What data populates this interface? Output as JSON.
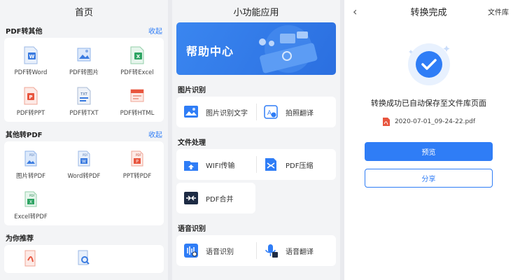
{
  "home": {
    "title": "首页",
    "pdf_to_other": {
      "heading": "PDF转其他",
      "action": "收起",
      "items": [
        {
          "label": "PDF转Word",
          "icon": "word-doc-icon"
        },
        {
          "label": "PDF转图片",
          "icon": "image-doc-icon"
        },
        {
          "label": "PDF转Excel",
          "icon": "excel-doc-icon"
        },
        {
          "label": "PDF转PPT",
          "icon": "ppt-doc-icon"
        },
        {
          "label": "PDF转TXT",
          "icon": "txt-doc-icon"
        },
        {
          "label": "PDF转HTML",
          "icon": "html-doc-icon"
        }
      ]
    },
    "other_to_pdf": {
      "heading": "其他转PDF",
      "action": "收起",
      "items": [
        {
          "label": "图片转PDF",
          "icon": "image-pdf-icon"
        },
        {
          "label": "Word转PDF",
          "icon": "word-pdf-icon"
        },
        {
          "label": "PPT转PDF",
          "icon": "ppt-pdf-icon"
        },
        {
          "label": "Excel转PDF",
          "icon": "excel-pdf-icon"
        }
      ]
    },
    "recommend": {
      "heading": "为你推荐"
    }
  },
  "tools": {
    "title": "小功能应用",
    "banner_text": "帮助中心",
    "groups": [
      {
        "heading": "图片识别",
        "items": [
          {
            "label": "图片识别文字",
            "icon": "image-text-icon"
          },
          {
            "label": "拍照翻译",
            "icon": "photo-translate-icon"
          }
        ]
      },
      {
        "heading": "文件处理",
        "items": [
          {
            "label": "WIFI传输",
            "icon": "wifi-transfer-icon"
          },
          {
            "label": "PDF压缩",
            "icon": "pdf-compress-icon"
          },
          {
            "label": "PDF合并",
            "icon": "pdf-merge-icon"
          }
        ]
      },
      {
        "heading": "语音识别",
        "items": [
          {
            "label": "语音识别",
            "icon": "voice-recognize-icon"
          },
          {
            "label": "语音翻译",
            "icon": "voice-translate-icon"
          }
        ]
      }
    ]
  },
  "done": {
    "title": "转换完成",
    "back": "‹",
    "library": "文件库",
    "message": "转换成功已自动保存至文件库页面",
    "filename": "2020-07-01_09-24-22.pdf",
    "preview": "预览",
    "share": "分享",
    "colors": {
      "accent": "#2f7df6",
      "pdf_red": "#e8553e"
    }
  }
}
